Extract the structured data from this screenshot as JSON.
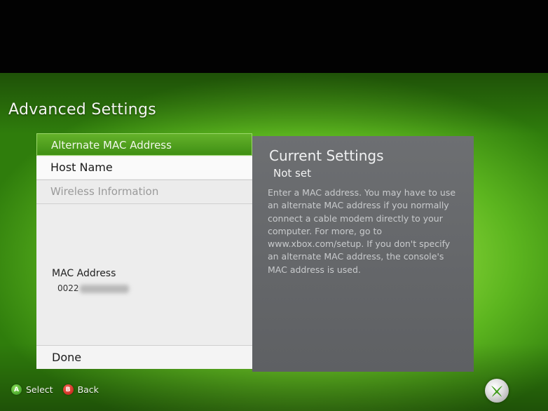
{
  "page": {
    "title": "Advanced Settings"
  },
  "menu": {
    "items": [
      {
        "label": "Alternate MAC Address",
        "state": "selected"
      },
      {
        "label": "Host Name",
        "state": "normal"
      },
      {
        "label": "Wireless Information",
        "state": "disabled"
      }
    ],
    "mac_label": "MAC Address",
    "mac_value_visible": "0022",
    "done_label": "Done"
  },
  "info": {
    "title": "Current Settings",
    "value": "Not set",
    "description": "Enter a MAC address. You may have to use an alternate MAC address if you normally connect a cable modem directly to your computer. For more, go to www.xbox.com/setup. If you don't specify an alternate MAC address, the console's MAC address is used."
  },
  "footer": {
    "a_glyph": "A",
    "a_label": "Select",
    "b_glyph": "B",
    "b_label": "Back"
  },
  "icons": {
    "logo": "xbox-logo-icon"
  },
  "colors": {
    "accent_green": "#4a9a1c",
    "panel_gray": "#666a6d",
    "b_red": "#d42a1e"
  }
}
